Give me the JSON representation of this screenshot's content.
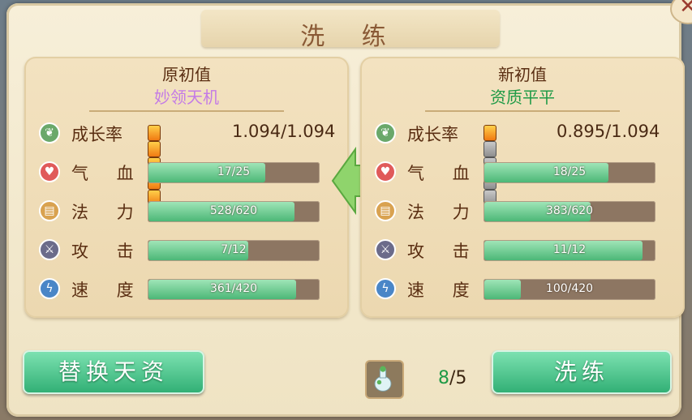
{
  "title": "洗 练",
  "close_icon": "close-icon",
  "panels": {
    "original": {
      "heading": "原初值",
      "quality": "妙领天机",
      "quality_color": "#c47be6",
      "growth_label": "成长率",
      "growth_value": "1.094/1.094",
      "growth_gems_filled": 5,
      "stats": [
        {
          "label": "气 血",
          "text": "17/25",
          "fraction": 0.68,
          "icon": "heart-icon"
        },
        {
          "label": "法 力",
          "text": "528/620",
          "fraction": 0.85,
          "icon": "scroll-icon"
        },
        {
          "label": "攻 击",
          "text": "7/12",
          "fraction": 0.58,
          "icon": "sword-icon"
        },
        {
          "label": "速 度",
          "text": "361/420",
          "fraction": 0.86,
          "icon": "lightning-icon"
        }
      ]
    },
    "new": {
      "heading": "新初值",
      "quality": "资质平平",
      "quality_color": "#1f9a46",
      "growth_label": "成长率",
      "growth_value": "0.895/1.094",
      "growth_gems_filled": 1,
      "stats": [
        {
          "label": "气 血",
          "text": "18/25",
          "fraction": 0.72,
          "icon": "heart-icon"
        },
        {
          "label": "法 力",
          "text": "383/620",
          "fraction": 0.62,
          "icon": "scroll-icon"
        },
        {
          "label": "攻 击",
          "text": "11/12",
          "fraction": 0.92,
          "icon": "sword-icon"
        },
        {
          "label": "速 度",
          "text": "100/420",
          "fraction": 0.21,
          "icon": "lightning-icon"
        }
      ]
    }
  },
  "replace_button": "替换天资",
  "refine_button": "洗练",
  "item_count": {
    "current": "8",
    "separator": "/",
    "total": "5"
  },
  "icon_colors": {
    "growth": "#6aa86a",
    "heart": "#e05a5a",
    "scroll": "#d9a250",
    "sword": "#6b6b8a",
    "lightning": "#4a86c7"
  }
}
